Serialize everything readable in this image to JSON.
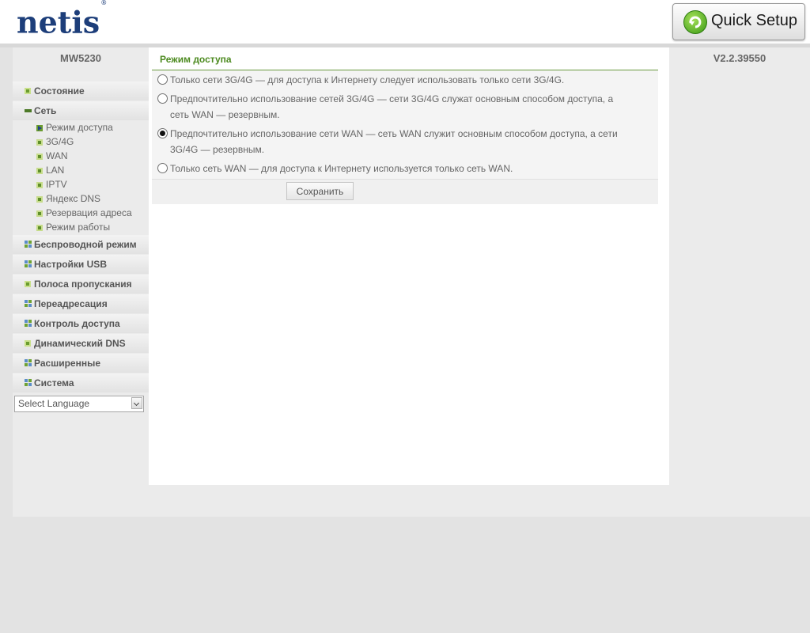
{
  "header": {
    "logo_text": "netis",
    "logo_mark": "®",
    "quick_setup_label": "Quick Setup",
    "quick_setup_icon": "refresh-arrow-icon"
  },
  "device": {
    "model": "MW5230",
    "version": "V2.2.39550"
  },
  "sidebar": {
    "items": [
      {
        "label": "Состояние",
        "icon": "green-square-icon"
      },
      {
        "label": "Сеть",
        "icon": "minus-icon",
        "expanded": true,
        "sub_items": [
          {
            "label": "Режим доступа",
            "icon": "arrow-right-icon",
            "active": true
          },
          {
            "label": "3G/4G",
            "icon": "green-square-icon"
          },
          {
            "label": "WAN",
            "icon": "green-square-icon"
          },
          {
            "label": "LAN",
            "icon": "green-square-icon"
          },
          {
            "label": "IPTV",
            "icon": "green-square-icon"
          },
          {
            "label": "Яндекс DNS",
            "icon": "green-square-icon"
          },
          {
            "label": "Резервация адреса",
            "icon": "green-square-icon"
          },
          {
            "label": "Режим работы",
            "icon": "green-square-icon"
          }
        ]
      },
      {
        "label": "Беспроводной режим",
        "icon": "grid-icon"
      },
      {
        "label": "Настройки USB",
        "icon": "grid-icon"
      },
      {
        "label": "Полоса пропускания",
        "icon": "green-square-icon"
      },
      {
        "label": "Переадресация",
        "icon": "grid-icon"
      },
      {
        "label": "Контроль доступа",
        "icon": "grid-icon"
      },
      {
        "label": "Динамический DNS",
        "icon": "green-square-icon"
      },
      {
        "label": "Расширенные",
        "icon": "grid-icon"
      },
      {
        "label": "Система",
        "icon": "grid-icon"
      }
    ],
    "language_select": {
      "selected": "Select Language"
    }
  },
  "content": {
    "title": "Режим доступа",
    "options": [
      {
        "line1": "Только сети 3G/4G — для доступа к Интернету следует использовать только сети 3G/4G.",
        "line2": "",
        "checked": false
      },
      {
        "line1": "Предпочтительно использование сетей 3G/4G — сети 3G/4G служат основным способом доступа, а",
        "line2": "сеть WAN — резервным.",
        "checked": false
      },
      {
        "line1": "Предпочтительно использование сети WAN — сеть WAN служит основным способом доступа, а сети",
        "line2": "3G/4G — резервным.",
        "checked": true
      },
      {
        "line1": "Только сеть WAN — для доступа к Интернету используется только сеть WAN.",
        "line2": "",
        "checked": false
      }
    ],
    "save_label": "Сохранить"
  },
  "colors": {
    "accent_green": "#4c8a1f",
    "logo_blue": "#1d3e7a",
    "page_bg": "#e3e3e3"
  }
}
